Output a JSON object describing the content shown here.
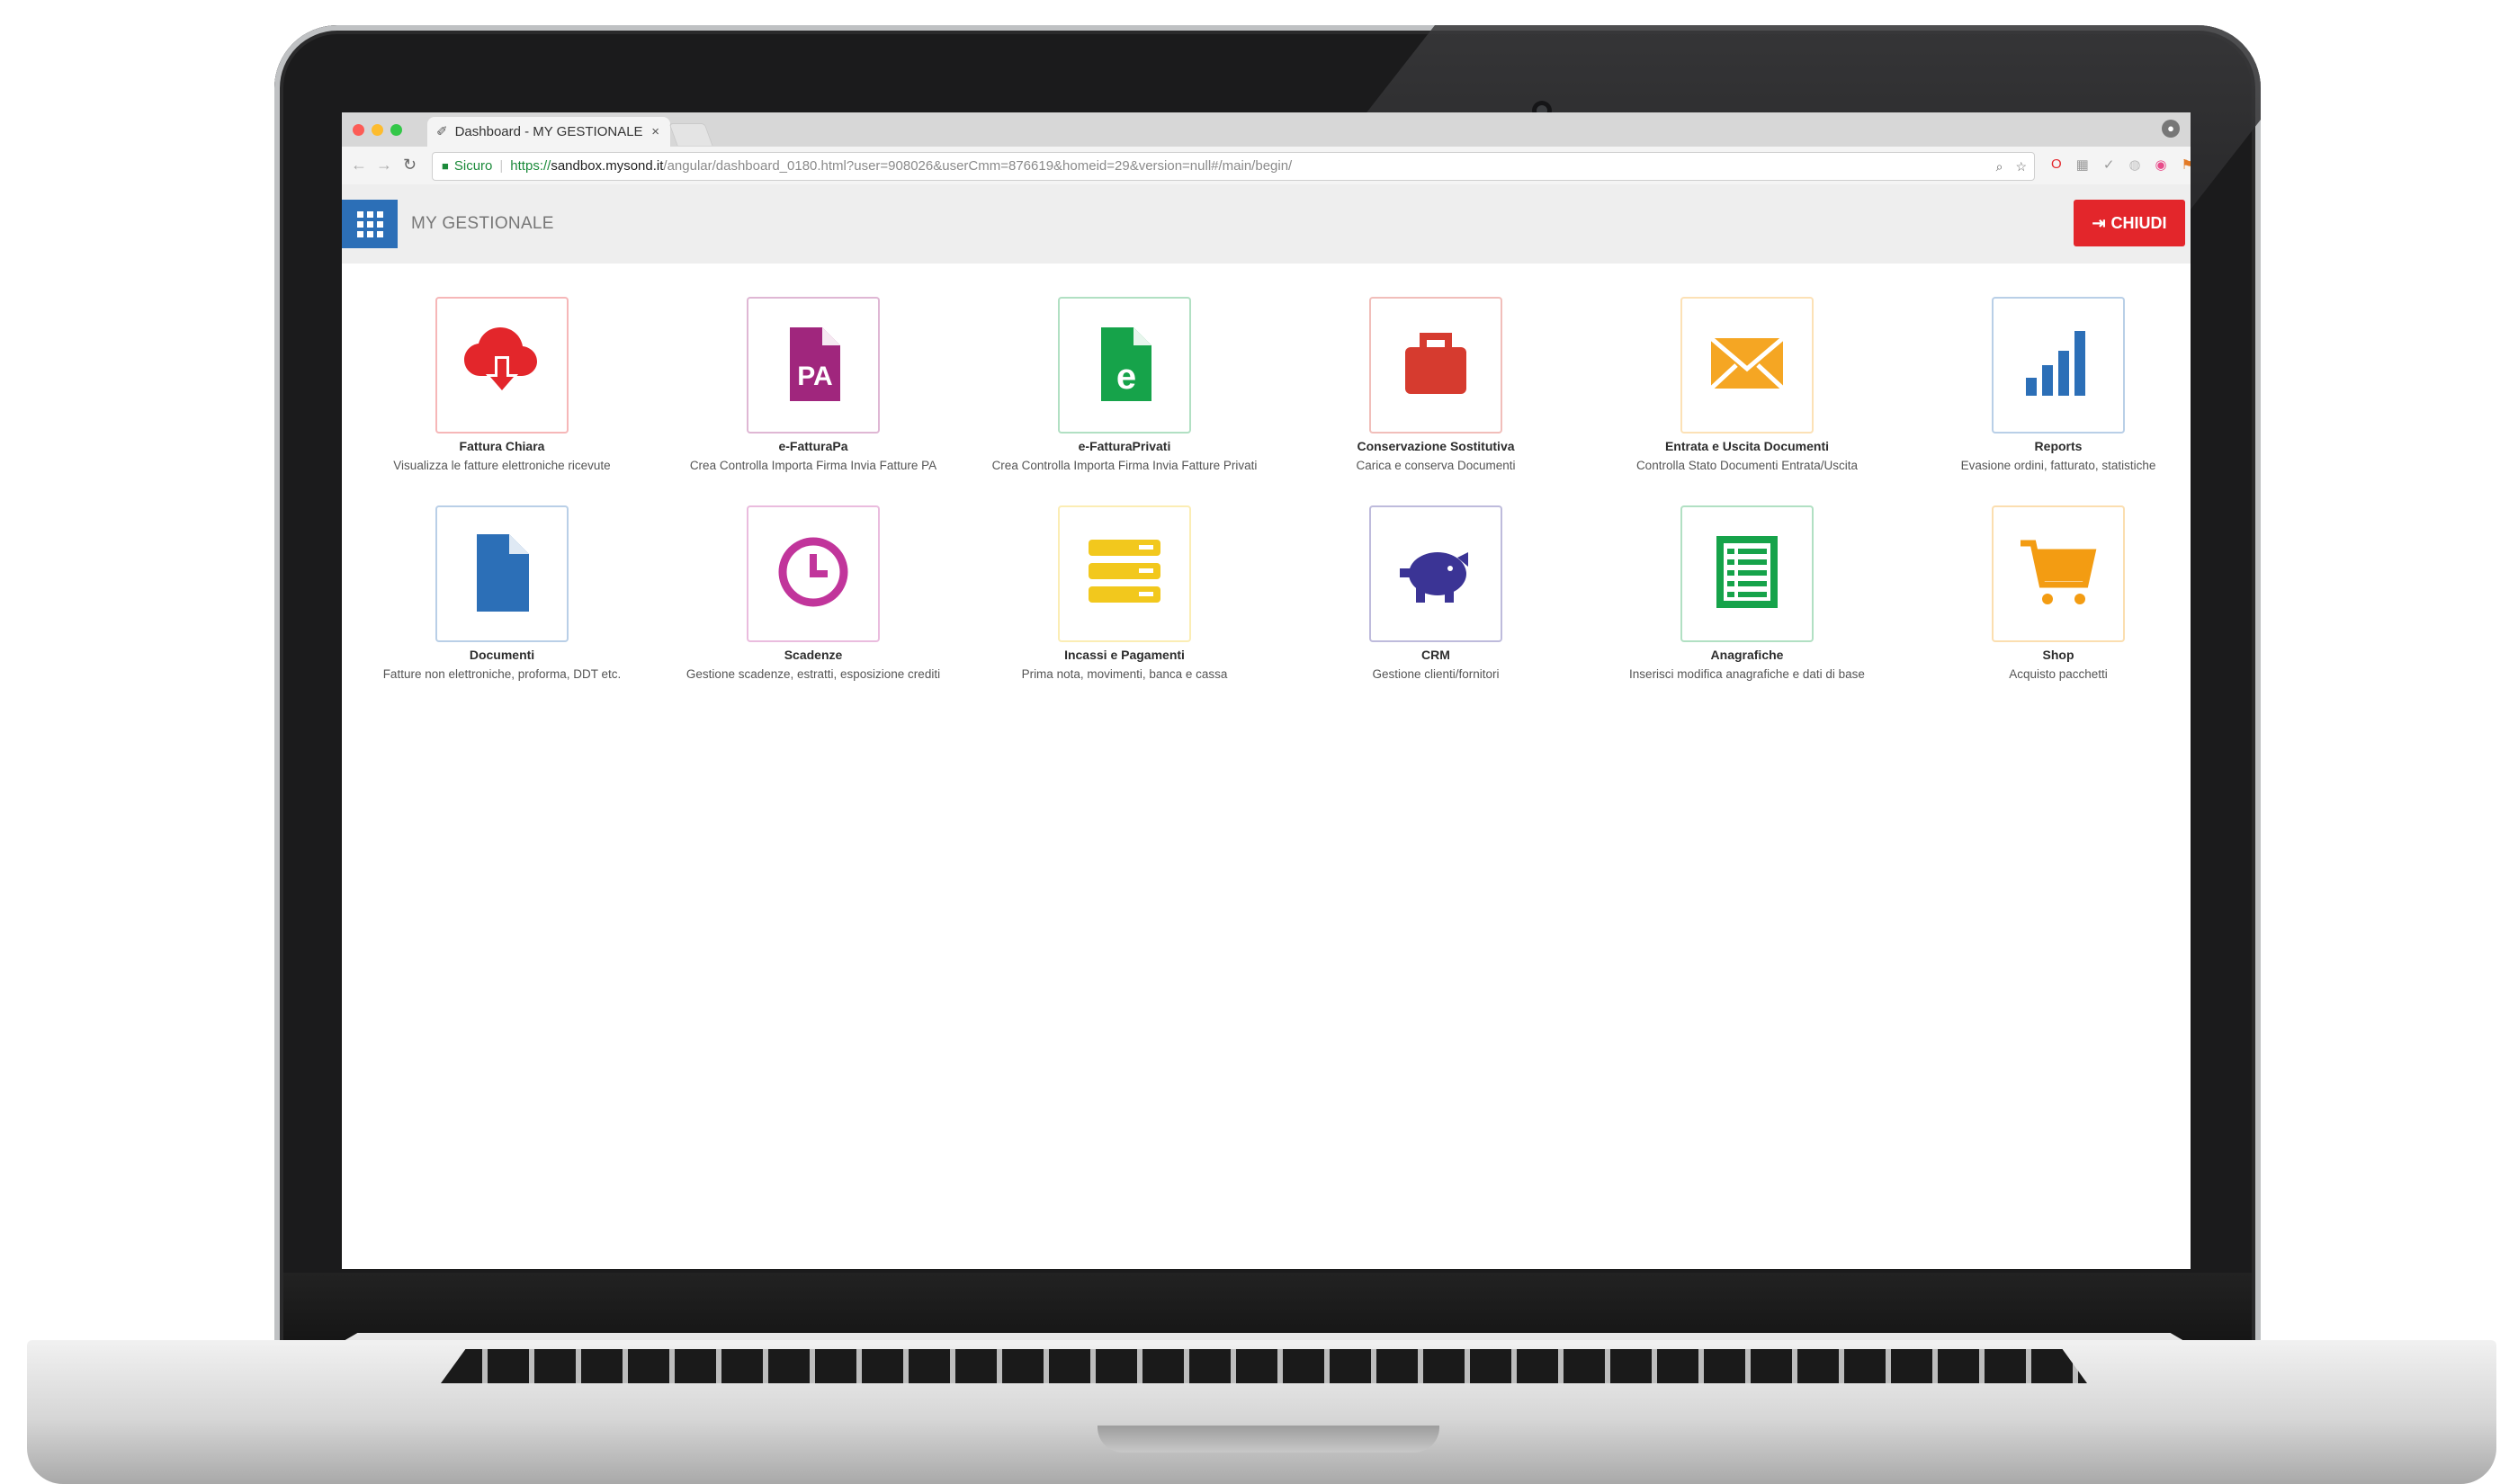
{
  "browser": {
    "tab_title": "Dashboard - MY GESTIONALE",
    "tab_close": "×",
    "secure_label": "Sicuro",
    "url_proto": "https://",
    "url_host": "sandbox.mysond.it",
    "url_path": "/angular/dashboard_0180.html?user=908026&userCmm=876619&homeid=29&version=null#/main/begin/"
  },
  "app": {
    "title": "MY GESTIONALE",
    "close_label": "CHIUDI"
  },
  "tiles": [
    {
      "title": "Fattura Chiara",
      "desc": "Visualizza le fatture elettroniche ricevute",
      "icon": "cloud-download-icon",
      "color": "#e3262b"
    },
    {
      "title": "e-FatturaPa",
      "desc": "Crea Controlla Importa Firma Invia Fatture PA",
      "icon": "pa-document-icon",
      "color": "#a0267d"
    },
    {
      "title": "e-FatturaPrivati",
      "desc": "Crea Controlla Importa Firma Invia Fatture Privati",
      "icon": "e-document-icon",
      "color": "#16a34a"
    },
    {
      "title": "Conservazione Sostitutiva",
      "desc": "Carica e conserva Documenti",
      "icon": "briefcase-icon",
      "color": "#d63b2f"
    },
    {
      "title": "Entrata e Uscita Documenti",
      "desc": "Controlla Stato Documenti Entrata/Uscita",
      "icon": "envelope-icon",
      "color": "#f5a623"
    },
    {
      "title": "Reports",
      "desc": "Evasione ordini, fatturato, statistiche",
      "icon": "bar-chart-icon",
      "color": "#2c6fb7"
    },
    {
      "title": "Documenti",
      "desc": "Fatture non elettroniche, proforma, DDT etc.",
      "icon": "document-icon",
      "color": "#2c6fb7"
    },
    {
      "title": "Scadenze",
      "desc": "Gestione scadenze, estratti, esposizione crediti",
      "icon": "clock-icon",
      "color": "#c1359b"
    },
    {
      "title": "Incassi e Pagamenti",
      "desc": "Prima nota, movimenti, banca e cassa",
      "icon": "stack-icon",
      "color": "#f2c81d"
    },
    {
      "title": "CRM",
      "desc": "Gestione clienti/fornitori",
      "icon": "piggy-bank-icon",
      "color": "#3b3495"
    },
    {
      "title": "Anagrafiche",
      "desc": "Inserisci modifica anagrafiche e dati di base",
      "icon": "list-icon",
      "color": "#16a34a"
    },
    {
      "title": "Shop",
      "desc": "Acquisto pacchetti",
      "icon": "cart-icon",
      "color": "#f39c12"
    }
  ]
}
